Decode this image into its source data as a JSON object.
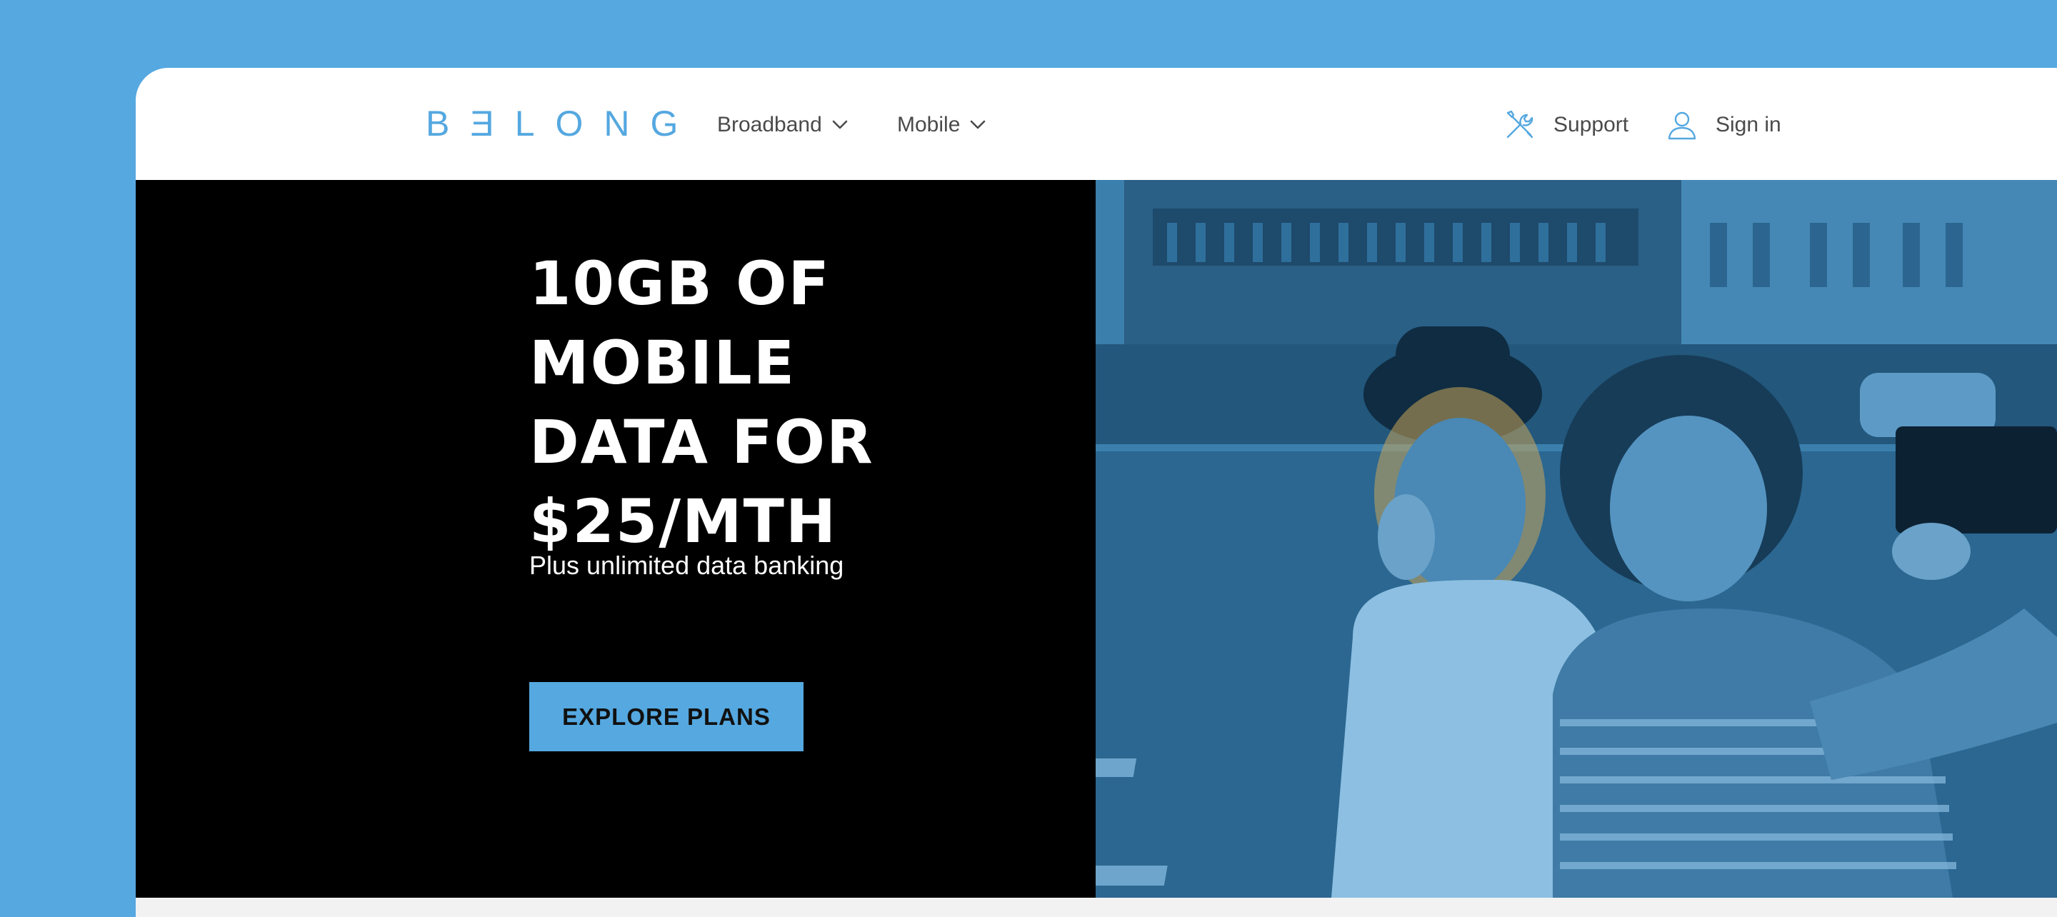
{
  "brand": {
    "logo_text": "BƎLONG",
    "accent_color": "#55a8e0"
  },
  "nav": {
    "items": [
      {
        "label": "Broadband",
        "icon": "chevron-down-icon"
      },
      {
        "label": "Mobile",
        "icon": "chevron-down-icon"
      }
    ]
  },
  "header_right": {
    "support_label": "Support",
    "support_icon": "tools-icon",
    "signin_label": "Sign in",
    "signin_icon": "user-icon"
  },
  "hero": {
    "headline": "10GB OF\nMOBILE\nDATA FOR\n$25/MTH",
    "subheadline": "Plus unlimited data banking",
    "cta_label": "EXPLORE PLANS",
    "image_icon": "hero-photo-two-women-selfie",
    "colors": {
      "left_background": "#000000",
      "photo_tint": "#2f6f9c"
    }
  }
}
